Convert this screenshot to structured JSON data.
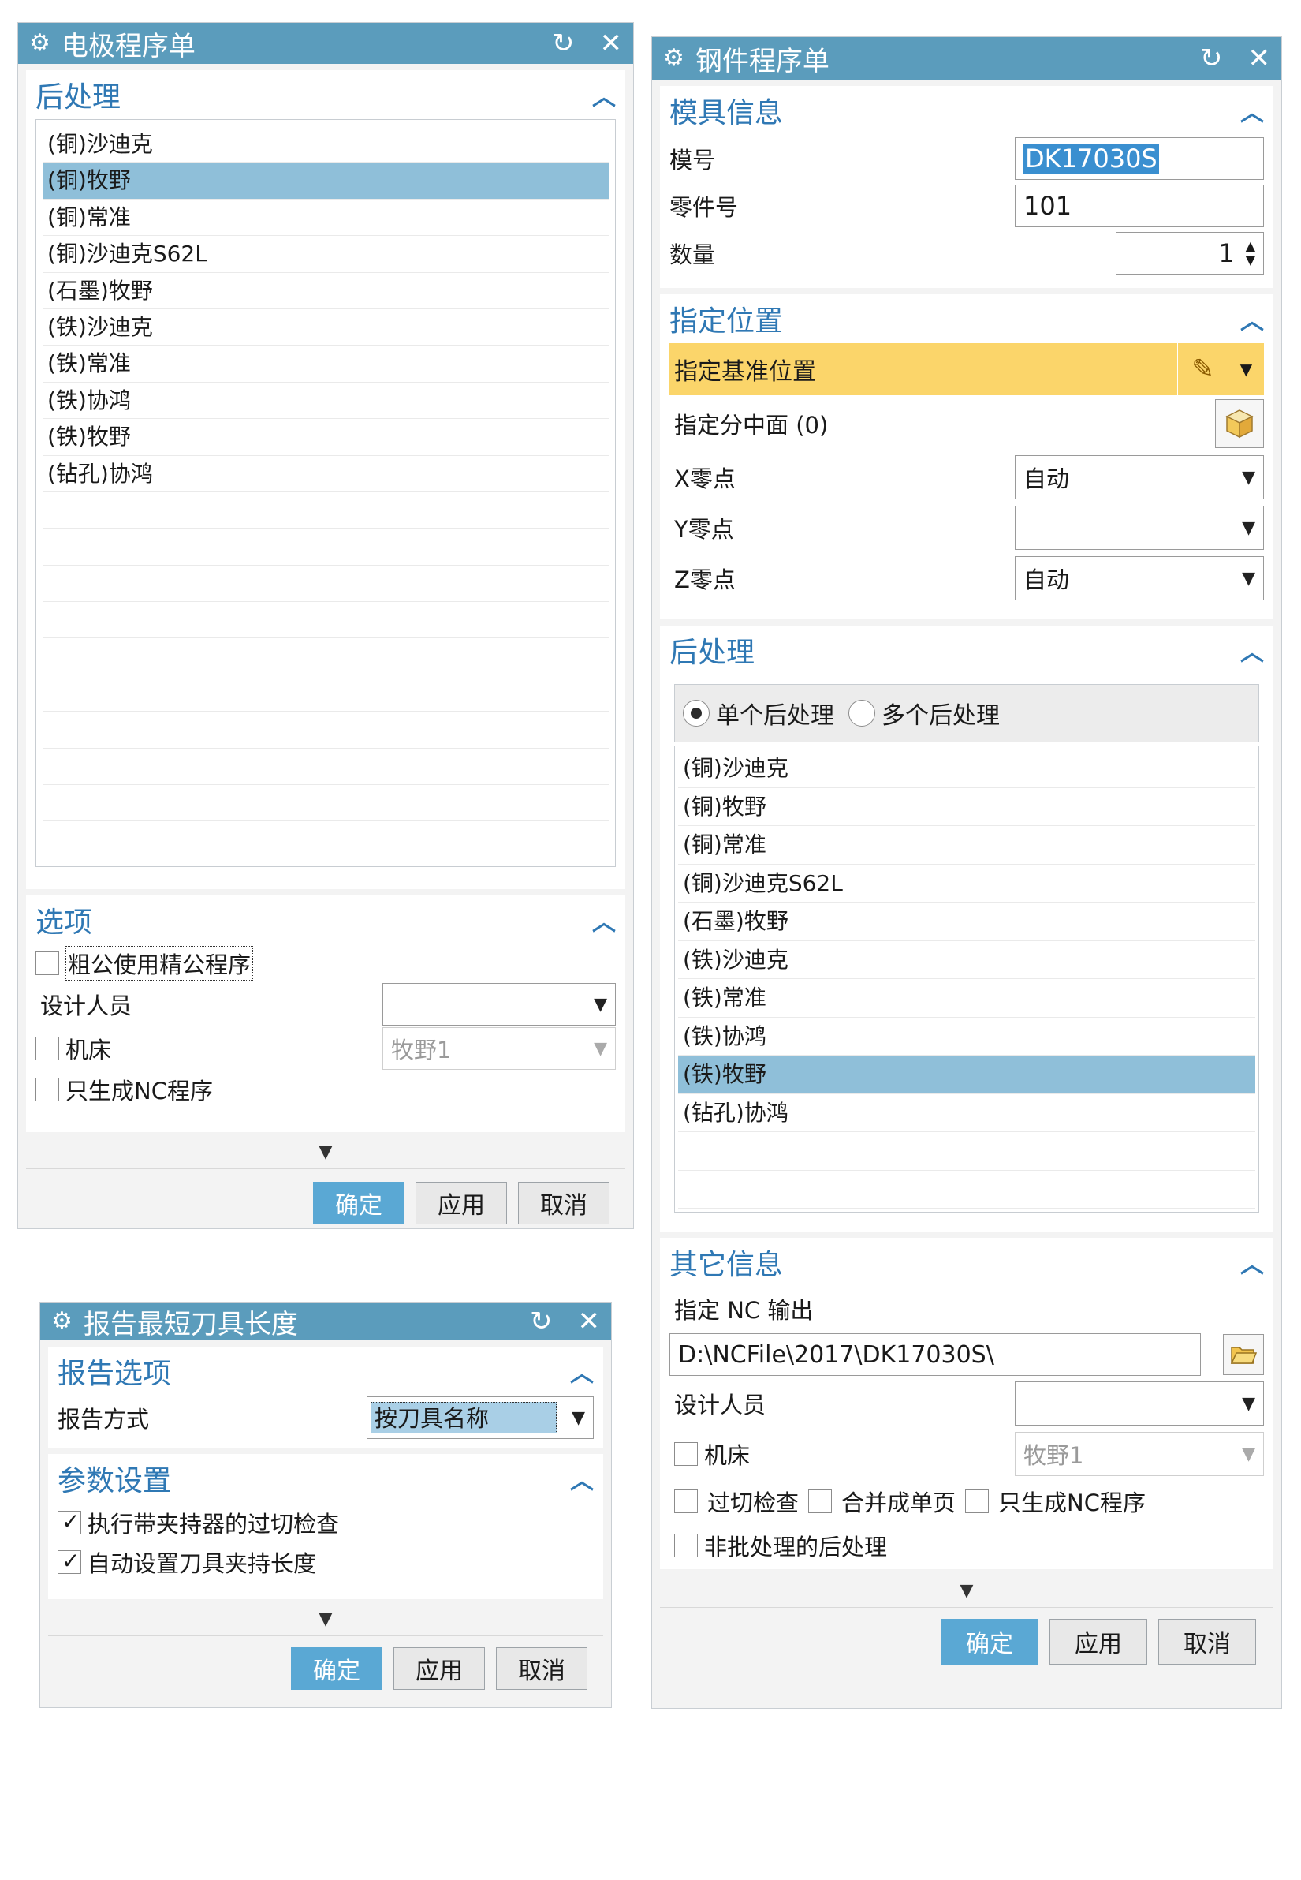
{
  "electrode_dialog": {
    "title": "电极程序单",
    "post_group": {
      "title": "后处理",
      "items": [
        "(铜)沙迪克",
        "(铜)牧野",
        "(铜)常准",
        "(铜)沙迪克S62L",
        "(石墨)牧野",
        "(铁)沙迪克",
        "(铁)常准",
        "(铁)协鸿",
        "(铁)牧野",
        "(钻孔)协鸿"
      ],
      "selected_index": 1
    },
    "options_group": {
      "title": "选项",
      "rough_finish_label": "粗公使用精公程序",
      "designer_label": "设计人员",
      "designer_value": "",
      "machine_label": "机床",
      "machine_value": "牧野1",
      "nc_only_label": "只生成NC程序"
    },
    "buttons": {
      "ok": "确定",
      "apply": "应用",
      "cancel": "取消"
    }
  },
  "report_dialog": {
    "title": "报告最短刀具长度",
    "report_group": {
      "title": "报告选项",
      "mode_label": "报告方式",
      "mode_value": "按刀具名称"
    },
    "param_group": {
      "title": "参数设置",
      "gouge_check_label": "执行带夹持器的过切检查",
      "auto_holder_label": "自动设置刀具夹持长度"
    },
    "buttons": {
      "ok": "确定",
      "apply": "应用",
      "cancel": "取消"
    }
  },
  "steel_dialog": {
    "title": "钢件程序单",
    "mold_group": {
      "title": "模具信息",
      "mold_no_label": "模号",
      "mold_no_value": "DK17030S",
      "part_no_label": "零件号",
      "part_no_value": "101",
      "qty_label": "数量",
      "qty_value": "1"
    },
    "position_group": {
      "title": "指定位置",
      "datum_label": "指定基准位置",
      "parting_label": "指定分中面 (0)",
      "x_label": "X零点",
      "x_value": "自动",
      "y_label": "Y零点",
      "y_value": "",
      "z_label": "Z零点",
      "z_value": "自动"
    },
    "post_group": {
      "title": "后处理",
      "single_label": "单个后处理",
      "multi_label": "多个后处理",
      "items": [
        "(铜)沙迪克",
        "(铜)牧野",
        "(铜)常准",
        "(铜)沙迪克S62L",
        "(石墨)牧野",
        "(铁)沙迪克",
        "(铁)常准",
        "(铁)协鸿",
        "(铁)牧野",
        "(钻孔)协鸿"
      ],
      "selected_index": 8
    },
    "other_group": {
      "title": "其它信息",
      "nc_output_label": "指定 NC 输出",
      "nc_output_value": "D:\\NCFile\\2017\\DK17030S\\",
      "designer_label": "设计人员",
      "designer_value": "",
      "machine_label": "机床",
      "machine_value": "牧野1",
      "gouge_label": "过切检查",
      "merge_label": "合并成单页",
      "nc_only_label": "只生成NC程序",
      "non_batch_label": "非批处理的后处理"
    },
    "buttons": {
      "ok": "确定",
      "apply": "应用",
      "cancel": "取消"
    }
  },
  "colors": {
    "title_bar": "#5b9cbc",
    "group_title": "#2f78b4",
    "selected_row": "#8fbfd9",
    "highlight": "#fbd56a",
    "primary_button": "#5aa8d4"
  }
}
